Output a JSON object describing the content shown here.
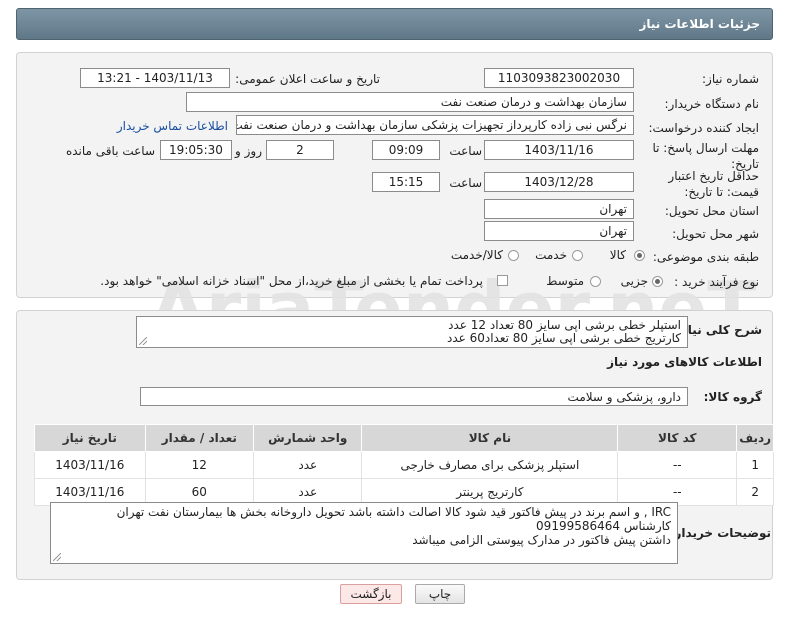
{
  "header": {
    "title": "جزئیات اطلاعات نیاز"
  },
  "form": {
    "need_number": {
      "label": "شماره نیاز:",
      "value": "1103093823002030"
    },
    "announce": {
      "label": "تاریخ و ساعت اعلان عمومی:",
      "value": "1403/11/13 - 13:21"
    },
    "buyer": {
      "label": "نام دستگاه خریدار:",
      "value": "سازمان بهداشت و درمان صنعت نفت"
    },
    "creator": {
      "label": "ایجاد کننده درخواست:",
      "value": "نرگس نبی زاده کارپرداز تجهیزات پزشکی سازمان بهداشت و درمان صنعت نفت",
      "contact_link": "اطلاعات تماس خریدار"
    },
    "reply_deadline": {
      "label": "مهلت ارسال پاسخ: تا تاریخ:",
      "date": "1403/11/16",
      "time_label": "ساعت",
      "time": "09:09",
      "days": "2",
      "days_label": "روز و",
      "remaining": "19:05:30",
      "remaining_label": "ساعت باقی مانده"
    },
    "price_validity": {
      "label": "حداقل تاریخ اعتبار قیمت: تا تاریخ:",
      "date": "1403/12/28",
      "time_label": "ساعت",
      "time": "15:15"
    },
    "province": {
      "label": "استان محل تحویل:",
      "value": "تهران"
    },
    "city": {
      "label": "شهر محل تحویل:",
      "value": "تهران"
    },
    "category": {
      "label": "طبقه بندی موضوعی:",
      "options": [
        "کالا",
        "خدمت",
        "کالا/خدمت"
      ],
      "selected": 0
    },
    "purchase_type": {
      "label": "نوع فرآیند خرید :",
      "options": [
        "جزیی",
        "متوسط"
      ],
      "selected": 0,
      "payment_note": "پرداخت تمام یا بخشی از مبلغ خرید،از محل \"اسناد خزانه اسلامی\" خواهد بود."
    }
  },
  "description": {
    "label": "شرح کلی نیاز:",
    "lines": [
      "استپلر خطی برشی  اپی سایز 80 تعداد 12 عدد",
      "کارتریج خطی برشی اپی سایز 80 تعداد60 عدد"
    ]
  },
  "goods_info": {
    "title": "اطلاعات کالاهای مورد نیاز",
    "group_label": "گروه کالا:",
    "group_value": "دارو، پزشکی و سلامت",
    "columns": [
      "ردیف",
      "کد کالا",
      "نام کالا",
      "واحد شمارش",
      "تعداد / مقدار",
      "تاریخ نیاز"
    ],
    "rows": [
      [
        "1",
        "--",
        "استپلر پزشکی برای مصارف خارجی",
        "عدد",
        "12",
        "1403/11/16"
      ],
      [
        "2",
        "--",
        "کارتریج پرینتر",
        "عدد",
        "60",
        "1403/11/16"
      ]
    ]
  },
  "buyer_notes": {
    "label": "توضیحات خریدار:",
    "lines": [
      "IRC , و اسم برند در پیش فاکتور قید شود کالا اصالت داشته باشد تحویل داروخانه بخش ها بیمارستان نفت تهران",
      "کارشناس 09199586464",
      "داشتن پیش فاکتور در مدارک پیوستی الزامی میباشد"
    ]
  },
  "buttons": {
    "print": "چاپ",
    "back": "بازگشت"
  },
  "watermark": "AriaTender.neT",
  "colors": {
    "header": "#6e8796",
    "link": "#1a4fa0",
    "back_button": "#fde8e8"
  }
}
